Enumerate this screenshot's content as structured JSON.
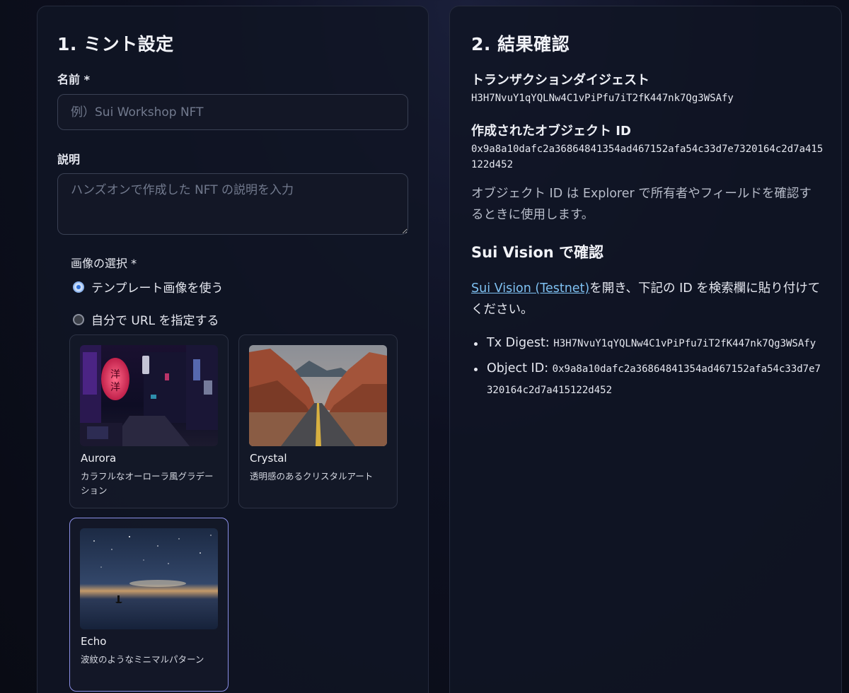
{
  "mint": {
    "title": "1. ミント設定",
    "name_label": "名前 *",
    "name_placeholder": "例）Sui Workshop NFT",
    "name_value": "",
    "desc_label": "説明",
    "desc_placeholder": "ハンズオンで作成した NFT の説明を入力",
    "desc_value": "",
    "image_label": "画像の選択 *",
    "radio_template": "テンプレート画像を使う",
    "radio_custom": "自分で URL を指定する",
    "selected_radio": "template",
    "templates": [
      {
        "name": "Aurora",
        "description": "カラフルなオーローラ風グラデーション",
        "image": "neon-alley-image",
        "selected": false
      },
      {
        "name": "Crystal",
        "description": "透明感のあるクリスタルアート",
        "image": "desert-road-image",
        "selected": false
      },
      {
        "name": "Echo",
        "description": "波紋のようなミニマルパターン",
        "image": "starry-lake-image",
        "selected": true
      }
    ]
  },
  "result": {
    "title": "2. 結果確認",
    "digest_label": "トランザクションダイジェスト",
    "digest_value": "H3H7NvuY1qYQLNw4C1vPiPfu7iT2fK447nk7Qg3WSAfy",
    "object_label": "作成されたオブジェクト ID",
    "object_value": "0x9a8a10dafc2a36864841354ad467152afa54c33d7e7320164c2d7a415122d452",
    "note": "オブジェクト ID は Explorer で所有者やフィールドを確認するときに使用します。",
    "vision_heading": "Sui Vision で確認",
    "vision_link": "Sui Vision (Testnet)",
    "vision_text": "を開き、下記の ID を検索欄に貼り付けてください。",
    "tx_digest_label": "Tx Digest:",
    "tx_digest_value": "H3H7NvuY1qYQLNw4C1vPiPfu7iT2fK447nk7Qg3WSAfy",
    "object_id_label": "Object ID:",
    "object_id_value": "0x9a8a10dafc2a36864841354ad467152afa54c33d7e7320164c2d7a415122d452"
  },
  "colors": {
    "accent_link": "#7fc1f2",
    "selected_card_border": "#8b8fe6",
    "background": "#0d1020"
  }
}
